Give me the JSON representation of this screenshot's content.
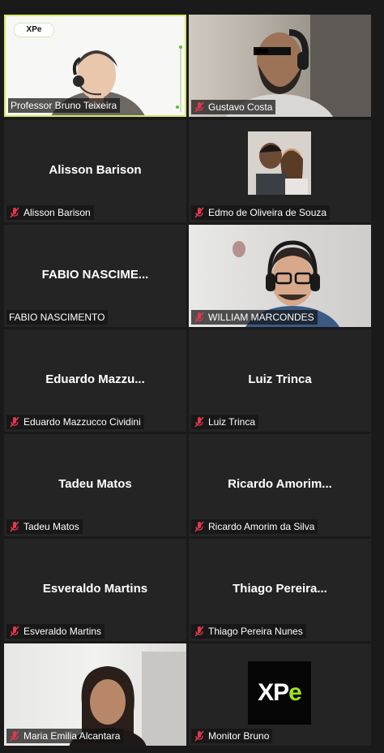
{
  "tiles": [
    {
      "name": "Professor Bruno Teixeira",
      "center": "",
      "muted": false,
      "type": "video-presenter"
    },
    {
      "name": "Gustavo Costa",
      "center": "",
      "muted": true,
      "type": "video-beard"
    },
    {
      "name": "Alisson Barison",
      "center": "Alisson Barison",
      "muted": true,
      "type": "name"
    },
    {
      "name": "Edmo de Oliveira de Souza",
      "center": "",
      "muted": true,
      "type": "photo"
    },
    {
      "name": "FABIO NASCIMENTO",
      "center": "FABIO NASCIME...",
      "muted": false,
      "type": "name"
    },
    {
      "name": "WILLIAM MARCONDES",
      "center": "",
      "muted": true,
      "type": "video-headset"
    },
    {
      "name": "Eduardo Mazzucco Cividini",
      "center": "Eduardo Mazzu...",
      "muted": true,
      "type": "name"
    },
    {
      "name": "Luiz Trinca",
      "center": "Luiz Trinca",
      "muted": true,
      "type": "name"
    },
    {
      "name": "Tadeu Matos",
      "center": "Tadeu Matos",
      "muted": true,
      "type": "name"
    },
    {
      "name": "Ricardo Amorim da Silva",
      "center": "Ricardo Amorim...",
      "muted": true,
      "type": "name"
    },
    {
      "name": "Esveraldo Martins",
      "center": "Esveraldo Martins",
      "muted": true,
      "type": "name"
    },
    {
      "name": "Thiago Pereira Nunes",
      "center": "Thiago Pereira...",
      "muted": true,
      "type": "name"
    },
    {
      "name": "Maria Emilia Alcantara",
      "center": "",
      "muted": true,
      "type": "video-woman"
    },
    {
      "name": "Monitor Bruno",
      "center": "",
      "muted": true,
      "type": "logo",
      "logo": {
        "a": "XP",
        "b": "e"
      }
    }
  ],
  "presenter_logo": "XPe",
  "colors": {
    "muted_icon": "#e5364d",
    "active_border": "#d7e86a",
    "logo_green": "#9fe31a"
  }
}
